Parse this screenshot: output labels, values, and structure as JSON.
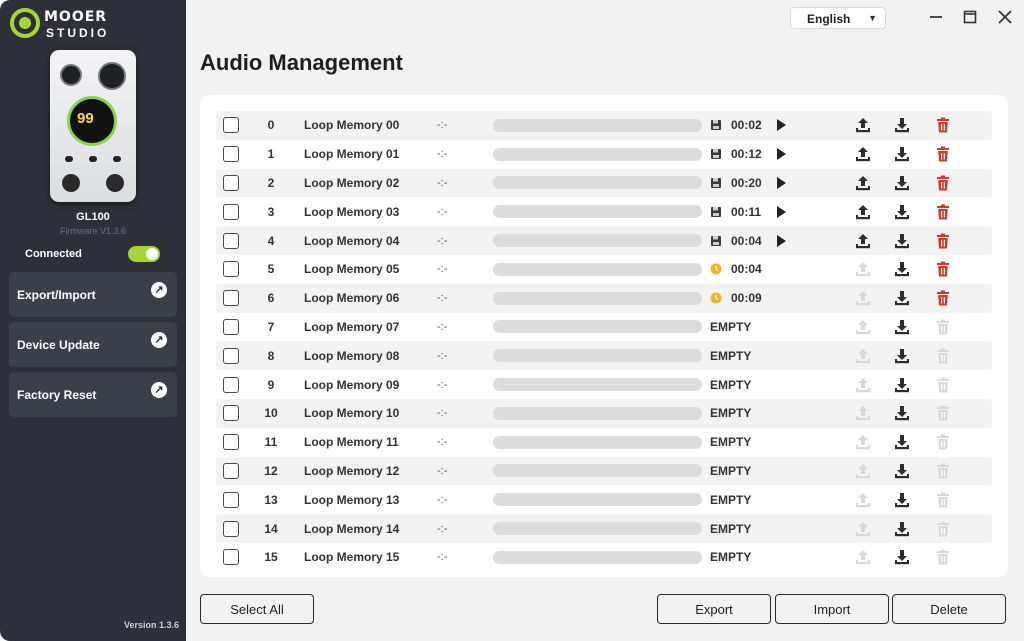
{
  "sidebar": {
    "logo": {
      "brand": "MOOER",
      "sub": "STUDIO"
    },
    "device": {
      "screen_value": "99",
      "name": "GL100",
      "firmware": "Firmware V1.3.6"
    },
    "connection": {
      "label": "Connected",
      "on": true
    },
    "buttons": [
      {
        "label": "Export/Import",
        "icon": "arrow-up-right-icon"
      },
      {
        "label": "Device Update",
        "icon": "arrow-up-right-icon"
      },
      {
        "label": "Factory Reset",
        "icon": "arrow-up-right-icon"
      }
    ],
    "version": "Version 1.3.6"
  },
  "header": {
    "language": "English",
    "window_controls": [
      "minimize-icon",
      "maximize-icon",
      "close-icon"
    ]
  },
  "page_title": "Audio Management",
  "colors": {
    "accent": "#a6d63a",
    "delete_active": "#d33a2c",
    "clock": "#f0b429",
    "sidebar_bg": "#2d3038"
  },
  "loops": [
    {
      "index": "0",
      "name": "Loop Memory 00",
      "marker": "-:-",
      "state": "saved",
      "duration": "00:02"
    },
    {
      "index": "1",
      "name": "Loop Memory 01",
      "marker": "-:-",
      "state": "saved",
      "duration": "00:12"
    },
    {
      "index": "2",
      "name": "Loop Memory 02",
      "marker": "-:-",
      "state": "saved",
      "duration": "00:20"
    },
    {
      "index": "3",
      "name": "Loop Memory 03",
      "marker": "-:-",
      "state": "saved",
      "duration": "00:11"
    },
    {
      "index": "4",
      "name": "Loop Memory 04",
      "marker": "-:-",
      "state": "saved",
      "duration": "00:04"
    },
    {
      "index": "5",
      "name": "Loop Memory 05",
      "marker": "-:-",
      "state": "pending",
      "duration": "00:04"
    },
    {
      "index": "6",
      "name": "Loop Memory 06",
      "marker": "-:-",
      "state": "pending",
      "duration": "00:09"
    },
    {
      "index": "7",
      "name": "Loop Memory 07",
      "marker": "-:-",
      "state": "empty",
      "duration": "EMPTY"
    },
    {
      "index": "8",
      "name": "Loop Memory 08",
      "marker": "-:-",
      "state": "empty",
      "duration": "EMPTY"
    },
    {
      "index": "9",
      "name": "Loop Memory 09",
      "marker": "-:-",
      "state": "empty",
      "duration": "EMPTY"
    },
    {
      "index": "10",
      "name": "Loop Memory 10",
      "marker": "-:-",
      "state": "empty",
      "duration": "EMPTY"
    },
    {
      "index": "11",
      "name": "Loop Memory 11",
      "marker": "-:-",
      "state": "empty",
      "duration": "EMPTY"
    },
    {
      "index": "12",
      "name": "Loop Memory 12",
      "marker": "-:-",
      "state": "empty",
      "duration": "EMPTY"
    },
    {
      "index": "13",
      "name": "Loop Memory 13",
      "marker": "-:-",
      "state": "empty",
      "duration": "EMPTY"
    },
    {
      "index": "14",
      "name": "Loop Memory 14",
      "marker": "-:-",
      "state": "empty",
      "duration": "EMPTY"
    },
    {
      "index": "15",
      "name": "Loop Memory 15",
      "marker": "-:-",
      "state": "empty",
      "duration": "EMPTY"
    }
  ],
  "actions": {
    "select_all": "Select All",
    "export": "Export",
    "import": "Import",
    "delete": "Delete"
  }
}
